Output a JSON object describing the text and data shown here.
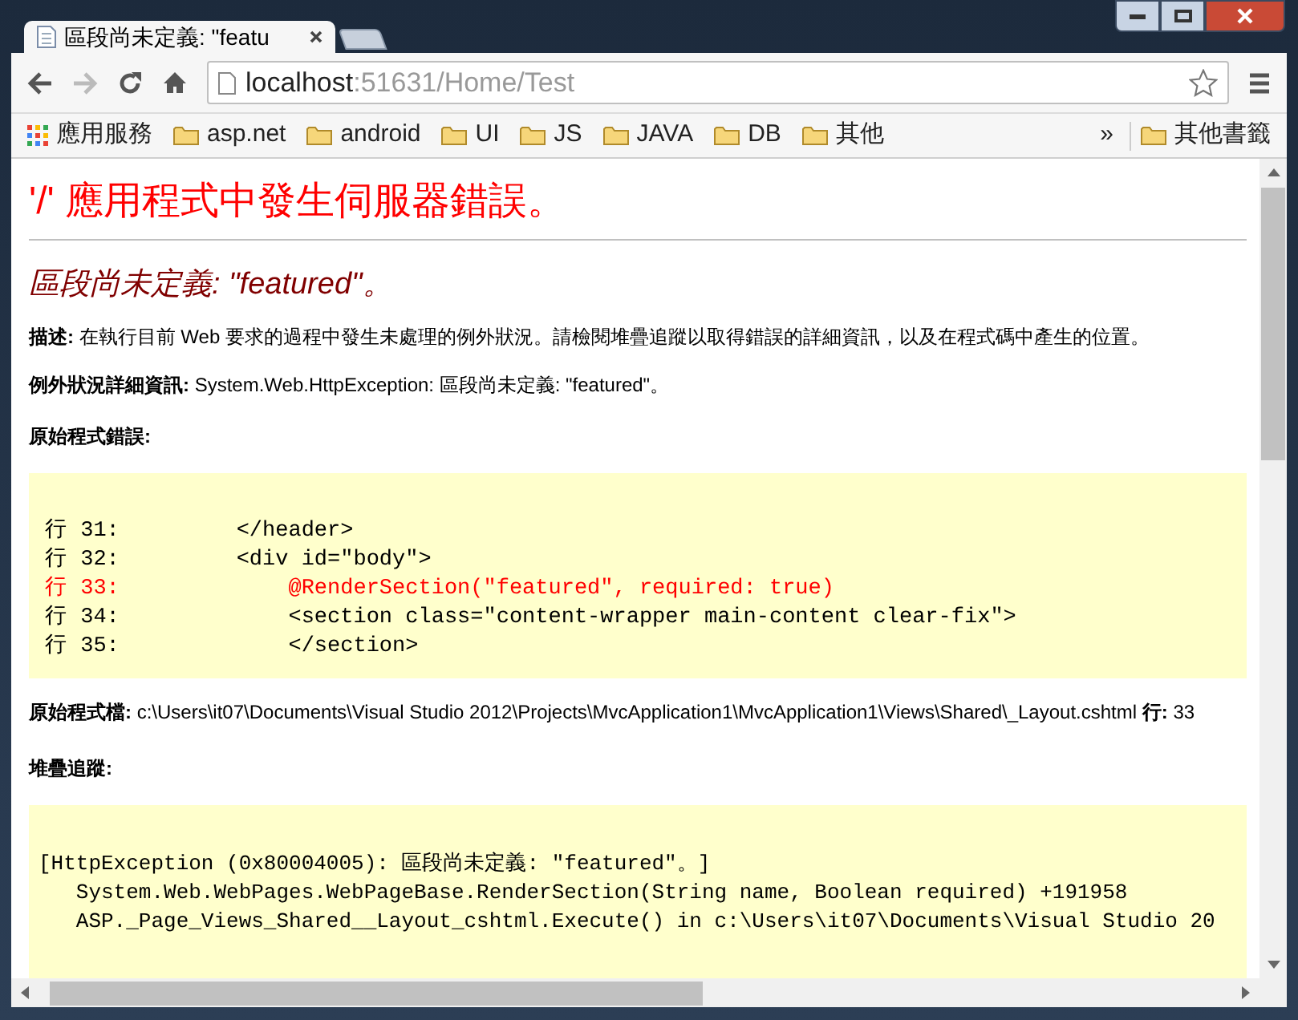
{
  "tabs": [
    {
      "title": "區段尚未定義: \"featu",
      "kind": "page",
      "selected": true
    },
    {
      "kind": "new-tab",
      "selected": false
    }
  ],
  "address_bar": {
    "host": "localhost",
    "path": ":51631/Home/Test"
  },
  "bookmarks": [
    {
      "label": "應用服務",
      "kind": "apps"
    },
    {
      "label": "asp.net",
      "kind": "folder"
    },
    {
      "label": "android",
      "kind": "folder"
    },
    {
      "label": "UI",
      "kind": "folder"
    },
    {
      "label": "JS",
      "kind": "folder"
    },
    {
      "label": "JAVA",
      "kind": "folder"
    },
    {
      "label": "DB",
      "kind": "folder"
    },
    {
      "label": "其他",
      "kind": "folder"
    }
  ],
  "bookmarks_overflow": "»",
  "other_bookmarks": "其他書籤",
  "page": {
    "title": "'/' 應用程式中發生伺服器錯誤。",
    "subtitle": "區段尚未定義: \"featured\"。",
    "description": "**描述:** 在執行目前 Web 要求的過程中發生未處理的例外狀況。請檢閱堆疊追蹤以取得錯誤的詳細資訊，以及在程式碼中產生的位置。",
    "exception_details": "**例外狀況詳細資訊:** System.Web.HttpException: 區段尚未定義: \"featured\"。",
    "source_error_heading": "原始程式錯誤:",
    "source_lines": [
      {
        "text": "行 31:         </header>",
        "error": false
      },
      {
        "text": "行 32:         <div id=\"body\">",
        "error": false
      },
      {
        "text": "行 33:             @RenderSection(\"featured\", required: true)",
        "error": true
      },
      {
        "text": "行 34:             <section class=\"content-wrapper main-content clear-fix\">",
        "error": false
      },
      {
        "text": "行 35:             </section>",
        "error": false
      }
    ],
    "source_file": "**原始程式檔:** c:\\Users\\it07\\Documents\\Visual Studio 2012\\Projects\\MvcApplication1\\MvcApplication1\\Views\\Shared\\_Layout.cshtml    **行:** 33",
    "stack_trace_heading": "堆疊追蹤:",
    "stack_trace": [
      "[HttpException (0x80004005): 區段尚未定義: \"featured\"。]",
      "   System.Web.WebPages.WebPageBase.RenderSection(String name, Boolean required) +191958",
      "   ASP._Page_Views_Shared__Layout_cshtml.Execute() in c:\\Users\\it07\\Documents\\Visual Studio 20"
    ]
  }
}
